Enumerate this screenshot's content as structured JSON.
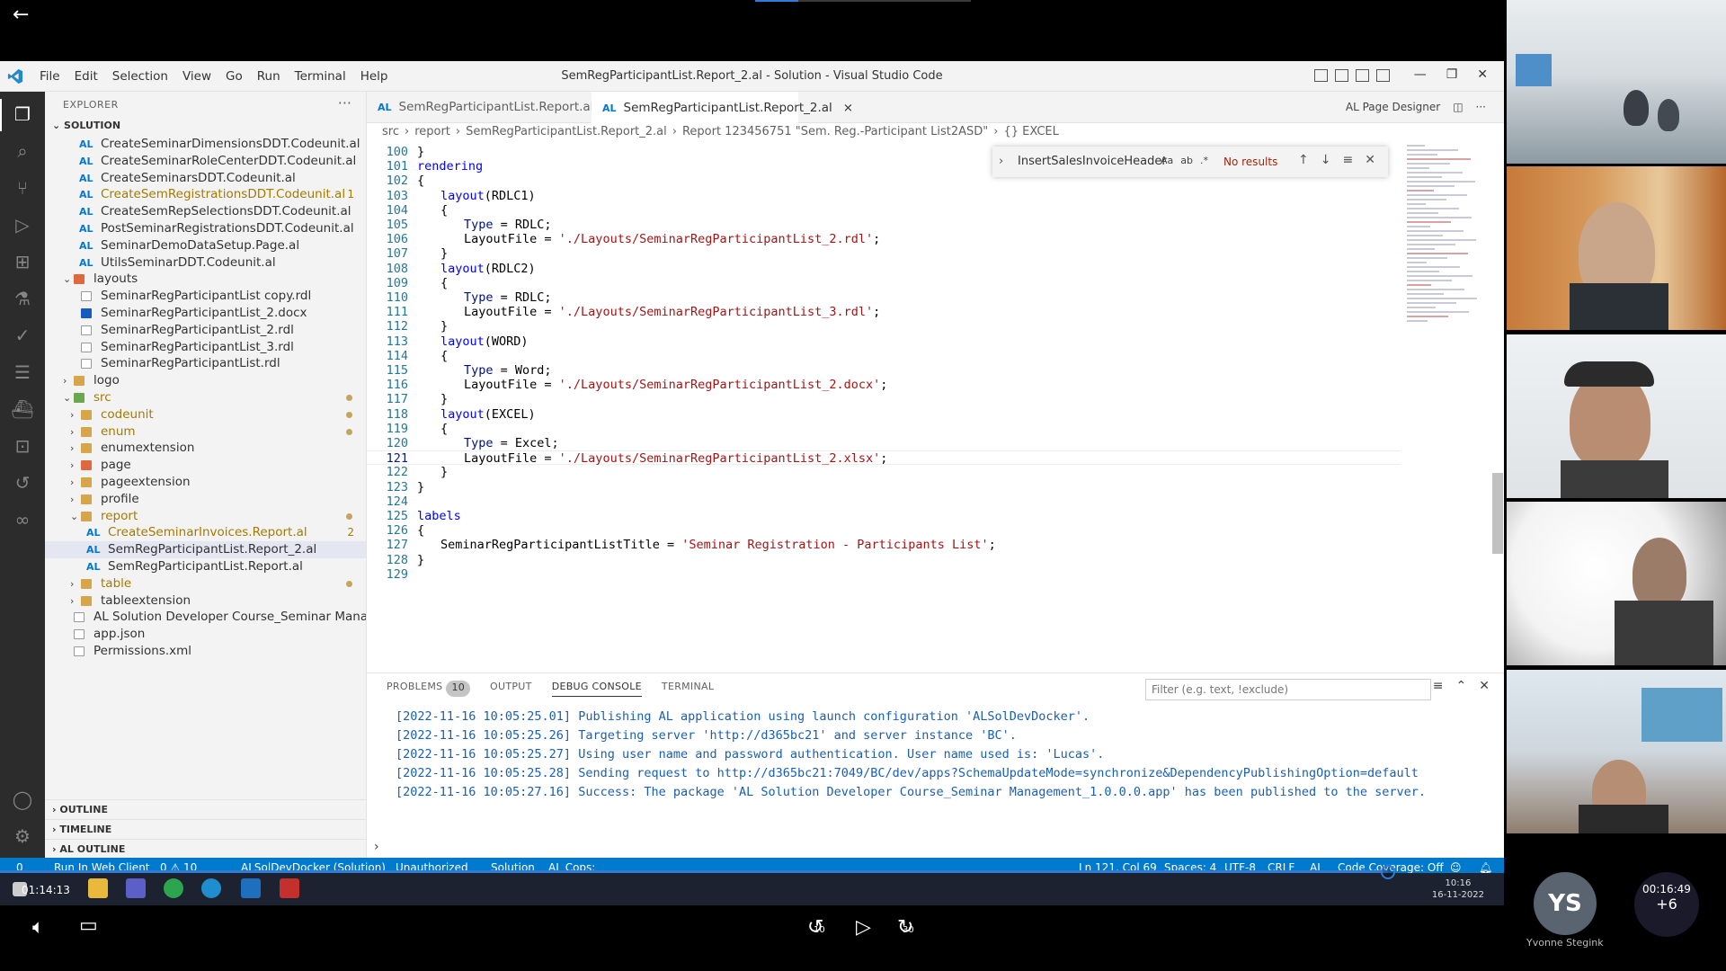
{
  "player": {
    "elapsed": "01:14:13",
    "remaining": "00:16:49",
    "skip_back": "10",
    "skip_forward": "30"
  },
  "vscode": {
    "menu": [
      "File",
      "Edit",
      "Selection",
      "View",
      "Go",
      "Run",
      "Terminal",
      "Help"
    ],
    "window_title": "SemRegParticipantList.Report_2.al - Solution - Visual Studio Code",
    "explorer_label": "EXPLORER",
    "section_solution": "SOLUTION",
    "tree": [
      {
        "label": "CreateSeminarDimensionsDDT.Codeunit.al",
        "type": "al",
        "indent": 2,
        "color": "#333"
      },
      {
        "label": "CreateSeminarRoleCenterDDT.Codeunit.al",
        "type": "al",
        "indent": 2,
        "color": "#333"
      },
      {
        "label": "CreateSeminarsDDT.Codeunit.al",
        "type": "al",
        "indent": 2,
        "color": "#333"
      },
      {
        "label": "CreateSemRegistrationsDDT.Codeunit.al",
        "type": "al",
        "indent": 2,
        "color": "#a57a00",
        "badge": "1"
      },
      {
        "label": "CreateSemRepSelectionsDDT.Codeunit.al",
        "type": "al",
        "indent": 2,
        "color": "#333"
      },
      {
        "label": "PostSeminarRegistrationsDDT.Codeunit.al",
        "type": "al",
        "indent": 2,
        "color": "#333"
      },
      {
        "label": "SeminarDemoDataSetup.Page.al",
        "type": "al",
        "indent": 2,
        "color": "#333"
      },
      {
        "label": "UtilsSeminarDDT.Codeunit.al",
        "type": "al",
        "indent": 2,
        "color": "#333"
      },
      {
        "label": "layouts",
        "type": "folder-layout",
        "indent": 1,
        "open": true,
        "color": "#333"
      },
      {
        "label": "SeminarRegParticipantList copy.rdl",
        "type": "blank",
        "indent": 2,
        "color": "#333"
      },
      {
        "label": "SeminarRegParticipantList_2.docx",
        "type": "word",
        "indent": 2,
        "color": "#333"
      },
      {
        "label": "SeminarRegParticipantList_2.rdl",
        "type": "blank",
        "indent": 2,
        "color": "#333"
      },
      {
        "label": "SeminarRegParticipantList_3.rdl",
        "type": "blank",
        "indent": 2,
        "color": "#333"
      },
      {
        "label": "SeminarRegParticipantList.rdl",
        "type": "blank",
        "indent": 2,
        "color": "#333"
      },
      {
        "label": "logo",
        "type": "folder",
        "indent": 1,
        "open": false,
        "color": "#333"
      },
      {
        "label": "src",
        "type": "folder-src",
        "indent": 1,
        "open": true,
        "color": "#a57a00",
        "dot": true
      },
      {
        "label": "codeunit",
        "type": "folder",
        "indent": 2,
        "open": false,
        "color": "#a57a00",
        "dot": true
      },
      {
        "label": "enum",
        "type": "folder",
        "indent": 2,
        "open": false,
        "color": "#a57a00",
        "dot": true
      },
      {
        "label": "enumextension",
        "type": "folder",
        "indent": 2,
        "open": false,
        "color": "#333"
      },
      {
        "label": "page",
        "type": "folder-layout",
        "indent": 2,
        "open": false,
        "color": "#333"
      },
      {
        "label": "pageextension",
        "type": "folder",
        "indent": 2,
        "open": false,
        "color": "#333"
      },
      {
        "label": "profile",
        "type": "folder",
        "indent": 2,
        "open": false,
        "color": "#333"
      },
      {
        "label": "report",
        "type": "folder",
        "indent": 2,
        "open": true,
        "color": "#a57a00",
        "dot": true
      },
      {
        "label": "CreateSeminarInvoices.Report.al",
        "type": "al",
        "indent": 3,
        "color": "#a57a00",
        "badge": "2"
      },
      {
        "label": "SemRegParticipantList.Report_2.al",
        "type": "al",
        "indent": 3,
        "color": "#333",
        "selected": true
      },
      {
        "label": "SemRegParticipantList.Report.al",
        "type": "al",
        "indent": 3,
        "color": "#333"
      },
      {
        "label": "table",
        "type": "folder",
        "indent": 2,
        "open": false,
        "color": "#a57a00",
        "dot": true
      },
      {
        "label": "tableextension",
        "type": "folder",
        "indent": 2,
        "open": false,
        "color": "#333"
      },
      {
        "label": "AL Solution Developer Course_Seminar Manage...",
        "type": "blank",
        "indent": 1,
        "color": "#333"
      },
      {
        "label": "app.json",
        "type": "json",
        "indent": 1,
        "color": "#333"
      },
      {
        "label": "Permissions.xml",
        "type": "xml",
        "indent": 1,
        "color": "#333"
      }
    ],
    "outline": "OUTLINE",
    "timeline": "TIMELINE",
    "al_outline": "AL OUTLINE",
    "tabs": [
      {
        "label": "SemRegParticipantList.Report.al",
        "active": false
      },
      {
        "label": "SemRegParticipantList.Report_2.al",
        "active": true
      }
    ],
    "tab_prefix": "AL",
    "tab_close": "×",
    "page_designer": "AL Page Designer",
    "breadcrumb": [
      "src",
      "report",
      "SemRegParticipantList.Report_2.al",
      "Report 123456751 \"Sem. Reg.-Participant List2ASD\"",
      "{} EXCEL"
    ],
    "find": {
      "query": "InsertSalesInvoiceHeader",
      "opts": [
        "Aa",
        "ab",
        ".*"
      ],
      "result": "No results"
    },
    "code_lines": [
      {
        "n": "100",
        "indent": 1,
        "tokens": [
          {
            "t": "}",
            "c": "plain"
          }
        ]
      },
      {
        "n": "101",
        "indent": 1,
        "tokens": [
          {
            "t": "rendering",
            "c": "kw"
          }
        ]
      },
      {
        "n": "102",
        "indent": 1,
        "tokens": [
          {
            "t": "{",
            "c": "plain"
          }
        ]
      },
      {
        "n": "103",
        "indent": 2,
        "tokens": [
          {
            "t": "layout",
            "c": "kw"
          },
          {
            "t": "(RDLC1)",
            "c": "plain"
          }
        ]
      },
      {
        "n": "104",
        "indent": 2,
        "tokens": [
          {
            "t": "{",
            "c": "plain"
          }
        ]
      },
      {
        "n": "105",
        "indent": 3,
        "tokens": [
          {
            "t": "Type",
            "c": "id"
          },
          {
            "t": " = RDLC;",
            "c": "plain"
          }
        ]
      },
      {
        "n": "106",
        "indent": 3,
        "tokens": [
          {
            "t": "LayoutFile",
            "c": "plain"
          },
          {
            "t": " = ",
            "c": "plain"
          },
          {
            "t": "'./Layouts/SeminarRegParticipantList_2.rdl'",
            "c": "str"
          },
          {
            "t": ";",
            "c": "plain"
          }
        ]
      },
      {
        "n": "107",
        "indent": 2,
        "tokens": [
          {
            "t": "}",
            "c": "plain"
          }
        ]
      },
      {
        "n": "108",
        "indent": 2,
        "tokens": [
          {
            "t": "layout",
            "c": "kw"
          },
          {
            "t": "(RDLC2)",
            "c": "plain"
          }
        ]
      },
      {
        "n": "109",
        "indent": 2,
        "tokens": [
          {
            "t": "{",
            "c": "plain"
          }
        ]
      },
      {
        "n": "110",
        "indent": 3,
        "tokens": [
          {
            "t": "Type",
            "c": "id"
          },
          {
            "t": " = RDLC;",
            "c": "plain"
          }
        ]
      },
      {
        "n": "111",
        "indent": 3,
        "tokens": [
          {
            "t": "LayoutFile",
            "c": "plain"
          },
          {
            "t": " = ",
            "c": "plain"
          },
          {
            "t": "'./Layouts/SeminarRegParticipantList_3.rdl'",
            "c": "str"
          },
          {
            "t": ";",
            "c": "plain"
          }
        ]
      },
      {
        "n": "112",
        "indent": 2,
        "tokens": [
          {
            "t": "}",
            "c": "plain"
          }
        ]
      },
      {
        "n": "113",
        "indent": 2,
        "tokens": [
          {
            "t": "layout",
            "c": "kw"
          },
          {
            "t": "(WORD)",
            "c": "plain"
          }
        ]
      },
      {
        "n": "114",
        "indent": 2,
        "tokens": [
          {
            "t": "{",
            "c": "plain"
          }
        ]
      },
      {
        "n": "115",
        "indent": 3,
        "tokens": [
          {
            "t": "Type",
            "c": "id"
          },
          {
            "t": " = Word;",
            "c": "plain"
          }
        ]
      },
      {
        "n": "116",
        "indent": 3,
        "tokens": [
          {
            "t": "LayoutFile",
            "c": "plain"
          },
          {
            "t": " = ",
            "c": "plain"
          },
          {
            "t": "'./Layouts/SeminarRegParticipantList_2.docx'",
            "c": "str"
          },
          {
            "t": ";",
            "c": "plain"
          }
        ]
      },
      {
        "n": "117",
        "indent": 2,
        "tokens": [
          {
            "t": "}",
            "c": "plain"
          }
        ]
      },
      {
        "n": "118",
        "indent": 2,
        "tokens": [
          {
            "t": "layout",
            "c": "kw"
          },
          {
            "t": "(EXCEL)",
            "c": "plain"
          }
        ]
      },
      {
        "n": "119",
        "indent": 2,
        "tokens": [
          {
            "t": "{",
            "c": "plain"
          }
        ]
      },
      {
        "n": "120",
        "indent": 3,
        "tokens": [
          {
            "t": "Type",
            "c": "id"
          },
          {
            "t": " = Excel;",
            "c": "plain"
          }
        ]
      },
      {
        "n": "121",
        "indent": 3,
        "current": true,
        "tokens": [
          {
            "t": "LayoutFile",
            "c": "plain"
          },
          {
            "t": " = ",
            "c": "plain"
          },
          {
            "t": "'./Layouts/SeminarRegParticipantList_2.xlsx'",
            "c": "str"
          },
          {
            "t": ";",
            "c": "plain"
          }
        ]
      },
      {
        "n": "122",
        "indent": 2,
        "tokens": [
          {
            "t": "}",
            "c": "plain"
          }
        ]
      },
      {
        "n": "123",
        "indent": 1,
        "tokens": [
          {
            "t": "}",
            "c": "plain"
          }
        ]
      },
      {
        "n": "124",
        "indent": 0,
        "tokens": []
      },
      {
        "n": "125",
        "indent": 1,
        "tokens": [
          {
            "t": "labels",
            "c": "kw"
          }
        ]
      },
      {
        "n": "126",
        "indent": 1,
        "tokens": [
          {
            "t": "{",
            "c": "plain"
          }
        ]
      },
      {
        "n": "127",
        "indent": 2,
        "tokens": [
          {
            "t": "SeminarRegParticipantListTitle",
            "c": "plain"
          },
          {
            "t": " = ",
            "c": "plain"
          },
          {
            "t": "'Seminar Registration - Participants List'",
            "c": "str"
          },
          {
            "t": ";",
            "c": "plain"
          }
        ]
      },
      {
        "n": "128",
        "indent": 1,
        "tokens": [
          {
            "t": "}",
            "c": "plain"
          }
        ]
      },
      {
        "n": "129",
        "indent": 0,
        "tokens": []
      }
    ],
    "panel": {
      "tabs": [
        "PROBLEMS",
        "OUTPUT",
        "DEBUG CONSOLE",
        "TERMINAL"
      ],
      "problems_count": "10",
      "active_tab": "DEBUG CONSOLE",
      "filter_placeholder": "Filter (e.g. text, !exclude)",
      "console": [
        "[2022-11-16 10:05:25.01] Publishing AL application using launch configuration 'ALSolDevDocker'.",
        "[2022-11-16 10:05:25.26] Targeting server 'http://d365bc21' and server instance 'BC'.",
        "[2022-11-16 10:05:25.27] Using user name and password authentication. User name used is: 'Lucas'.",
        "[2022-11-16 10:05:25.28] Sending request to http://d365bc21:7049/BC/dev/apps?SchemaUpdateMode=synchronize&DependencyPublishingOption=default",
        "[2022-11-16 10:05:27.16] Success: The package 'AL Solution Developer Course_Seminar Management_1.0.0.0.app' has been published to the server."
      ]
    },
    "status": {
      "left": [
        "0",
        "Run In Web Client",
        "0 ⚠ 10",
        "ALSolDevDocker (Solution)",
        "Unauthorized",
        "Solution",
        "AL Cops:"
      ],
      "right": [
        "Ln 121, Col 69",
        "Spaces: 4",
        "UTF-8",
        "CRLF",
        "AL",
        "Code Coverage: Off"
      ]
    }
  },
  "taskbar": {
    "time": "10:16",
    "date": "16-11-2022"
  },
  "participants": {
    "avatar_initials": "YS",
    "avatar_name": "Yvonne Stegink",
    "more_count": "+6"
  }
}
